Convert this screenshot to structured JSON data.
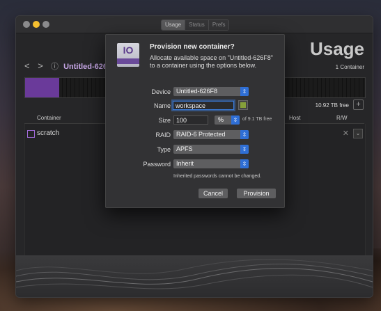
{
  "window": {
    "tabs": [
      {
        "label": "Usage",
        "active": true
      },
      {
        "label": "Status",
        "active": false
      },
      {
        "label": "Prefs",
        "active": false
      }
    ],
    "nav": {
      "back": "<",
      "forward": ">"
    },
    "breadcrumb": {
      "info_icon": "ⓘ",
      "label": "Untitled-626F"
    },
    "title": "Usage",
    "container_count": "1 Container",
    "usage_fraction": 0.1,
    "free_space": "10.92 TB free",
    "add_label": "+",
    "table": {
      "headers": {
        "container": "Container",
        "host": "Host",
        "rw": "R/W"
      },
      "rows": [
        {
          "name": "scratch",
          "swatch_color": "#a06ad8"
        }
      ]
    }
  },
  "dialog": {
    "icon_text": "IO",
    "title": "Provision new container?",
    "description": "Allocate available space on \"Untitled-626F8\" to a container using the options below.",
    "fields": {
      "device": {
        "label": "Device",
        "value": "Untitled-626F8"
      },
      "name": {
        "label": "Name",
        "value": "workspace",
        "color": "#86a03a"
      },
      "size": {
        "label": "Size",
        "value": "100",
        "unit": "%",
        "hint": "of 9.1 TB free"
      },
      "raid": {
        "label": "RAID",
        "value": "RAID-6 Protected"
      },
      "type": {
        "label": "Type",
        "value": "APFS"
      },
      "password": {
        "label": "Password",
        "value": "Inherit"
      }
    },
    "note": "Inherited passwords cannot be changed.",
    "buttons": {
      "cancel": "Cancel",
      "provision": "Provision"
    }
  },
  "colors": {
    "accent": "#2f6fd6",
    "container_purple": "#6a3a9a",
    "traffic_yellow": "#f5bf2f"
  }
}
